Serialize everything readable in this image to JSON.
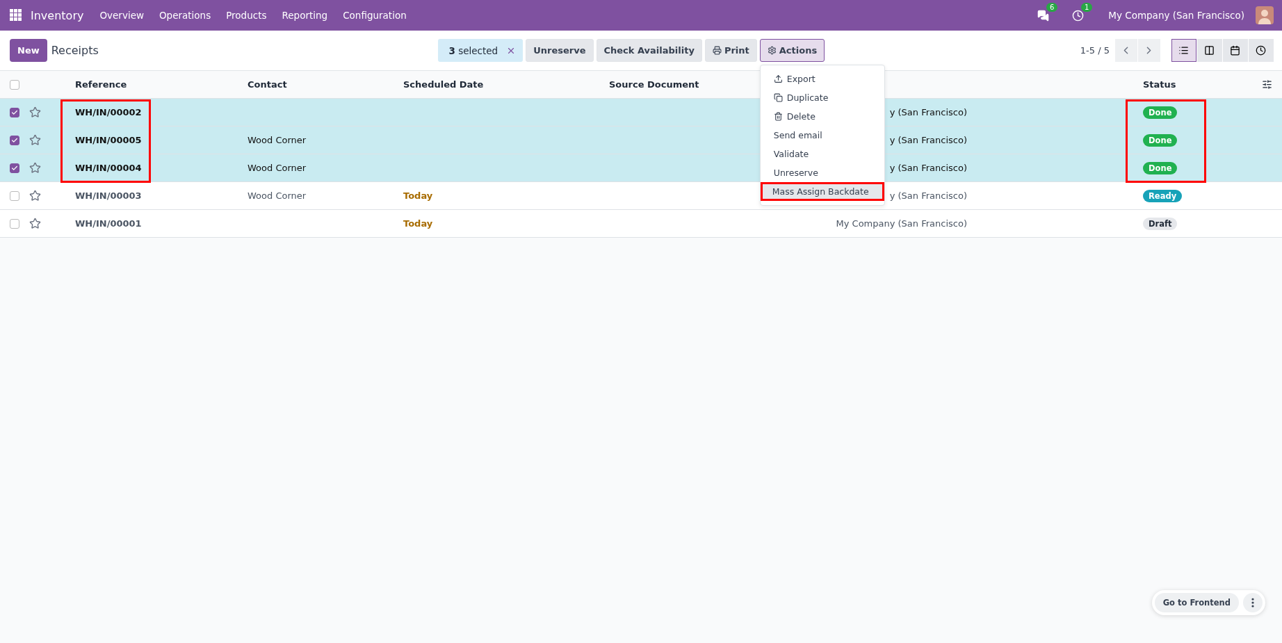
{
  "navbar": {
    "app_name": "Inventory",
    "menu": [
      "Overview",
      "Operations",
      "Products",
      "Reporting",
      "Configuration"
    ],
    "messages_count": "6",
    "activities_count": "1",
    "company": "My Company (San Francisco)"
  },
  "control_panel": {
    "new_button": "New",
    "title": "Receipts",
    "selection": {
      "count": "3",
      "label": "selected"
    },
    "buttons": [
      "Unreserve",
      "Check Availability"
    ],
    "print_button": "Print",
    "actions_button": {
      "label": "Actions",
      "expanded": true
    },
    "pager": "1-5 / 5",
    "views": [
      {
        "kind": "list",
        "selected": true
      },
      {
        "kind": "kanban",
        "selected": false
      },
      {
        "kind": "calendar",
        "selected": false
      },
      {
        "kind": "activity",
        "selected": false
      }
    ]
  },
  "actions_menu": [
    {
      "label": "Export",
      "kind": "export",
      "highlighted": false
    },
    {
      "label": "Duplicate",
      "kind": "duplicate",
      "highlighted": false
    },
    {
      "label": "Delete",
      "kind": "delete",
      "highlighted": false
    },
    {
      "label": "Send email",
      "kind": "plain",
      "highlighted": false
    },
    {
      "label": "Validate",
      "kind": "plain",
      "highlighted": false
    },
    {
      "label": "Unreserve",
      "kind": "plain",
      "highlighted": false
    },
    {
      "label": "Mass Assign Backdate",
      "kind": "plain",
      "highlighted": true
    }
  ],
  "table": {
    "columns": [
      {
        "label": "Reference",
        "framed": true
      },
      {
        "label": "Contact",
        "framed": false
      },
      {
        "label": "Scheduled Date",
        "framed": false
      },
      {
        "label": "Source Document",
        "framed": false
      },
      {
        "label": "Status",
        "framed": true
      }
    ],
    "all_selected": false,
    "rows": [
      {
        "selected": true,
        "starred": false,
        "reference": "WH/IN/00002",
        "contact": "",
        "scheduled_date": "",
        "company": "y (San Francisco)",
        "status": {
          "label": "Done",
          "kind": "done"
        }
      },
      {
        "selected": true,
        "starred": false,
        "reference": "WH/IN/00005",
        "contact": "Wood Corner",
        "scheduled_date": "",
        "company": "y (San Francisco)",
        "status": {
          "label": "Done",
          "kind": "done"
        }
      },
      {
        "selected": true,
        "starred": false,
        "reference": "WH/IN/00004",
        "contact": "Wood Corner",
        "scheduled_date": "",
        "company": "y (San Francisco)",
        "status": {
          "label": "Done",
          "kind": "done"
        }
      },
      {
        "selected": false,
        "starred": false,
        "reference": "WH/IN/00003",
        "contact": "Wood Corner",
        "scheduled_date": "Today",
        "company": "y (San Francisco)",
        "status": {
          "label": "Ready",
          "kind": "ready"
        }
      },
      {
        "selected": false,
        "starred": false,
        "reference": "WH/IN/00001",
        "contact": "",
        "scheduled_date": "Today",
        "company": "My Company (San Francisco)",
        "status": {
          "label": "Draft",
          "kind": "draft"
        }
      }
    ]
  },
  "frontend_button": "Go to Frontend"
}
